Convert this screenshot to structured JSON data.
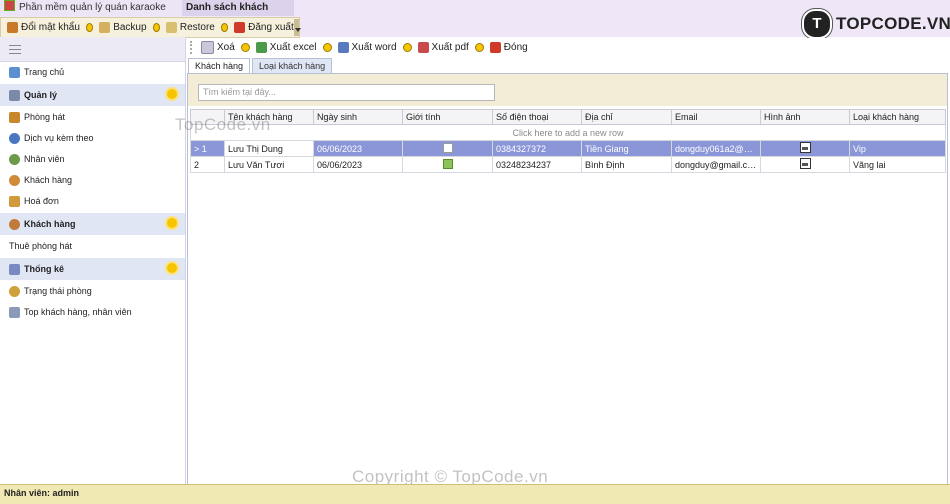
{
  "window": {
    "app_tab_label": "Phần mềm quản lý quán karaoke TM",
    "active_tab_label": "Danh sách khách hàng"
  },
  "logo": {
    "badge": "T",
    "text": "TOPCODE.VN"
  },
  "main_toolbar": {
    "change_password": "Đổi mật khẩu",
    "backup": "Backup",
    "restore": "Restore",
    "logout": "Đăng xuất"
  },
  "sidebar": {
    "items": [
      {
        "label": "Trang chủ",
        "type": "item",
        "icon": "home-icon",
        "color": "#5b8fd0"
      },
      {
        "label": "Quản lý",
        "type": "group",
        "icon": "manage-icon",
        "color": "#7a8aa8"
      },
      {
        "label": "Phòng hát",
        "type": "item",
        "icon": "room-icon",
        "color": "#c8872a"
      },
      {
        "label": "Dịch vụ kèm theo",
        "type": "item",
        "icon": "service-icon",
        "color": "#4a78c0"
      },
      {
        "label": "Nhân viên",
        "type": "item",
        "icon": "staff-icon",
        "color": "#6a9a4a"
      },
      {
        "label": "Khách hàng",
        "type": "item",
        "icon": "customer-icon",
        "color": "#d08a3a"
      },
      {
        "label": "Hoá đơn",
        "type": "item",
        "icon": "invoice-icon",
        "color": "#d09a3a"
      },
      {
        "label": "Khách hàng",
        "type": "group",
        "icon": "customer-group-icon",
        "color": "#c07a3a"
      },
      {
        "label": "Thuê phòng hát",
        "type": "item",
        "icon": "",
        "color": ""
      },
      {
        "label": "Thống kê",
        "type": "group",
        "icon": "stats-icon",
        "color": "#7a8ac0"
      },
      {
        "label": "Trạng thái phòng",
        "type": "item",
        "icon": "room-status-icon",
        "color": "#d0a03a"
      },
      {
        "label": "Top khách hàng, nhân viên",
        "type": "item",
        "icon": "top-list-icon",
        "color": "#8a9ab8"
      }
    ]
  },
  "content_toolbar": {
    "delete": "Xoá",
    "export_excel": "Xuất excel",
    "export_word": "Xuất word",
    "export_pdf": "Xuất pdf",
    "close": "Đóng"
  },
  "tabs": {
    "customers": "Khách hàng",
    "customer_types": "Loại khách hàng"
  },
  "search": {
    "placeholder": "Tìm kiếm tại đây..."
  },
  "grid": {
    "columns": [
      "Tên khách hàng",
      "Ngày sinh",
      "Giới tính",
      "Số điện thoại",
      "Địa chỉ",
      "Email",
      "Hình ảnh",
      "Loại khách hàng"
    ],
    "add_row_text": "Click here to add a new row",
    "rows": [
      {
        "indicator": ">",
        "no": "1",
        "name": "Lưu Thị Dung",
        "dob": "06/06/2023",
        "gender_checked": false,
        "phone": "0384327372",
        "address": "Tiền Giang",
        "email": "dongduy061a2@gmail...",
        "type": "Vip"
      },
      {
        "indicator": "",
        "no": "2",
        "name": "Lưu Văn Tươi",
        "dob": "06/06/2023",
        "gender_checked": true,
        "phone": "03248234237",
        "address": "Bình Định",
        "email": "dongduy@gmail.com",
        "type": "Vãng lai"
      }
    ]
  },
  "watermarks": {
    "left": "TopCode.vn",
    "bottom": "Copyright © TopCode.vn"
  },
  "status": {
    "user_label": "Nhân viên: admin"
  }
}
